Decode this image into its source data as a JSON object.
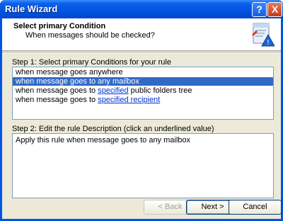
{
  "window": {
    "title": "Rule Wizard",
    "help_label": "?",
    "close_label": "X"
  },
  "header": {
    "title": "Select primary Condition",
    "subtitle": "When messages should be checked?",
    "icon": "wizard-document-icon"
  },
  "step1": {
    "label": "Step 1: Select primary Conditions for your rule",
    "items": [
      {
        "text": "when message goes anywhere"
      },
      {
        "text": "when message goes to any mailbox",
        "selected": true
      },
      {
        "prefix": "when message goes to ",
        "link": "specified",
        "suffix": " public folders tree"
      },
      {
        "prefix": "when message goes to ",
        "link": "specified recipient",
        "suffix": ""
      }
    ]
  },
  "step2": {
    "label": "Step 2: Edit the rule Description (click an underlined value)",
    "description": "Apply this rule when message goes to any mailbox"
  },
  "buttons": {
    "back": "< Back",
    "next": "Next >",
    "cancel": "Cancel"
  }
}
